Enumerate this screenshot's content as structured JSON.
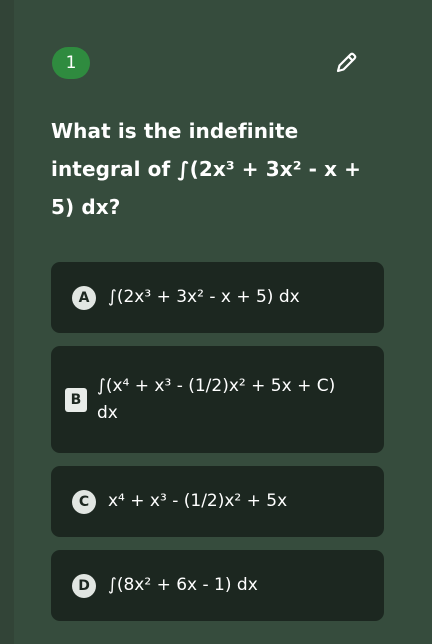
{
  "question": {
    "number": "1",
    "text": "What is the indefinite integral of ∫(2x³ + 3x² - x + 5) dx?"
  },
  "options": [
    {
      "letter": "A",
      "text": "∫(2x³ + 3x² - x + 5) dx"
    },
    {
      "letter": "B",
      "text": "∫(x⁴ + x³ - (1/2)x² + 5x + C) dx"
    },
    {
      "letter": "C",
      "text": "x⁴ + x³ - (1/2)x² + 5x"
    },
    {
      "letter": "D",
      "text": "∫(8x² + 6x - 1) dx"
    }
  ],
  "icons": {
    "edit": "pencil-icon"
  },
  "colors": {
    "panel": "#364c3d",
    "option_bg": "#1c2720",
    "badge": "#2f8b3f"
  }
}
